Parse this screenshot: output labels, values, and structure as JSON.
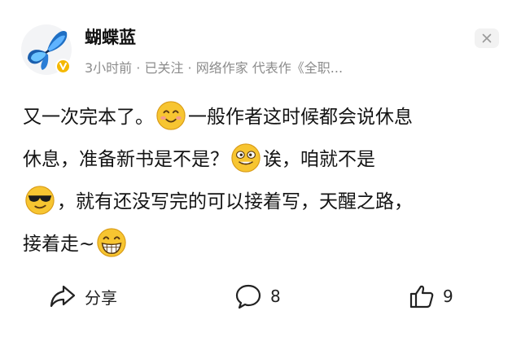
{
  "post": {
    "author": {
      "name": "蝴蝶蓝",
      "avatar_icon": "butterfly-avatar",
      "badge_icon": "verified-v-icon",
      "badge_color": "#f5b800"
    },
    "meta": "3小时前 · 已关注 · 网络作家 代表作《全职...",
    "close_icon": "close-icon",
    "content": {
      "line1_a": "又一次完本了。",
      "line1_b": "一般作者这时候都会说休息",
      "line2_a": "休息，准备新书是不是？",
      "line2_b": "诶，咱就不是",
      "line3_b": "，就有还没写完的可以接着写，天醒之路，",
      "line4_a": "接着走~",
      "emojis": [
        "smile-emoji",
        "silly-emoji",
        "cool-sunglasses-emoji",
        "grin-emoji"
      ]
    }
  },
  "actions": {
    "share": {
      "icon": "share-icon",
      "label": "分享"
    },
    "comment": {
      "icon": "comment-icon",
      "count": "8"
    },
    "like": {
      "icon": "thumbs-up-icon",
      "count": "9"
    }
  },
  "colors": {
    "meta_text": "#8c8c8c",
    "emoji_yellow": "#f7c531"
  }
}
